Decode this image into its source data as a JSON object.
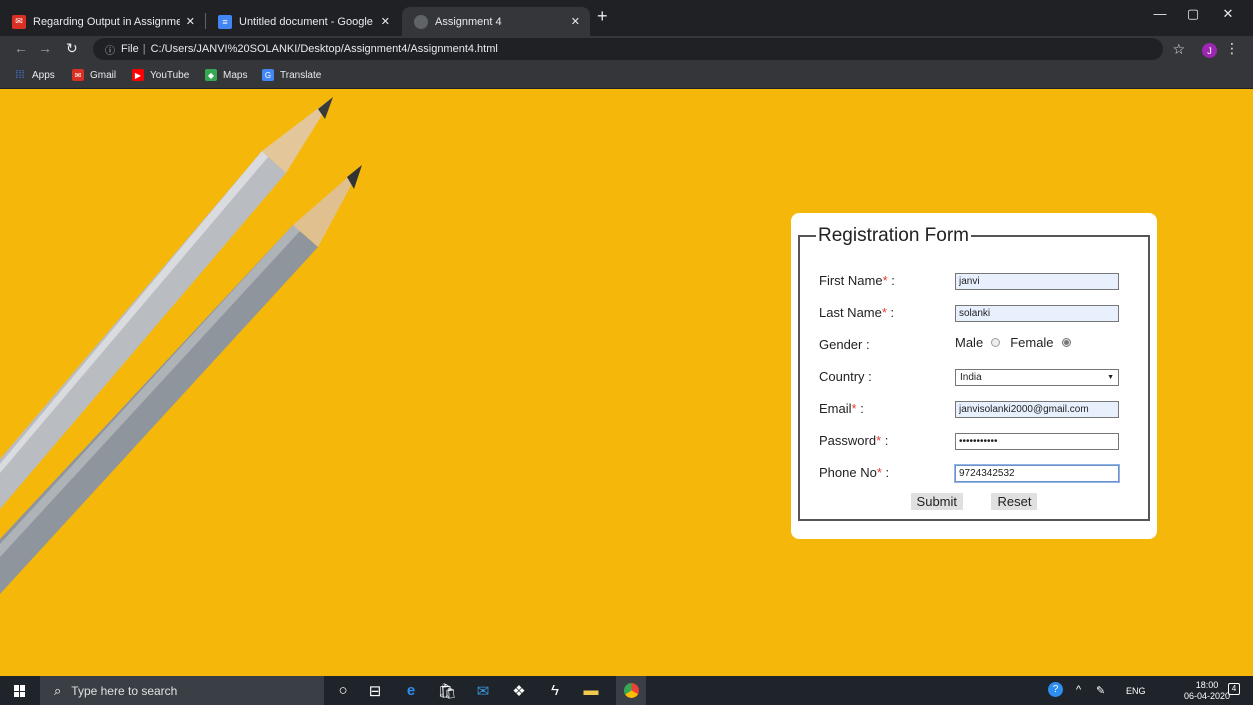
{
  "browser": {
    "tabs": [
      {
        "title": "Regarding Output in Assignment",
        "favicon": "gmail-icon",
        "color": "#d93025",
        "active": false
      },
      {
        "title": "Untitled document - Google Doc",
        "favicon": "docs-icon",
        "color": "#4285f4",
        "active": false
      },
      {
        "title": "Assignment 4",
        "favicon": "globe-icon",
        "color": "#5f6368",
        "active": true
      }
    ],
    "address": {
      "scheme_label": "File",
      "url": "C:/Users/JANVI%20SOLANKI/Desktop/Assignment4/Assignment4.html"
    },
    "profile_initial": "J",
    "bookmarks": [
      {
        "label": "Apps",
        "icon": "apps-grid-icon"
      },
      {
        "label": "Gmail",
        "icon": "gmail-icon"
      },
      {
        "label": "YouTube",
        "icon": "youtube-icon"
      },
      {
        "label": "Maps",
        "icon": "maps-icon"
      },
      {
        "label": "Translate",
        "icon": "translate-icon"
      }
    ]
  },
  "form": {
    "legend": "Registration Form",
    "fields": {
      "first_name": {
        "label": "First Name",
        "required_mark": "*",
        "suffix": " :",
        "value": "janvi"
      },
      "last_name": {
        "label": "Last Name",
        "required_mark": "*",
        "suffix": " :",
        "value": "solanki"
      },
      "gender": {
        "label": "Gender :",
        "options": [
          "Male",
          "Female"
        ],
        "selected": "Female"
      },
      "country": {
        "label": "Country :",
        "value": "India"
      },
      "email": {
        "label": "Email",
        "required_mark": "*",
        "suffix": " :",
        "value": "janvisolanki2000@gmail.com"
      },
      "password": {
        "label": "Password",
        "required_mark": "*",
        "suffix": " :",
        "value": "•••••••••••"
      },
      "phone": {
        "label": "Phone No",
        "required_mark": "*",
        "suffix": " :",
        "value": "9724342532"
      }
    },
    "submit_label": "Submit",
    "reset_label": "Reset"
  },
  "taskbar": {
    "search_placeholder": "Type here to search",
    "language": "ENG",
    "time": "18:00",
    "date": "06-04-2020",
    "notification_count": "4"
  },
  "colors": {
    "page_background": "#f5b80a",
    "required": "#e53935",
    "autofill": "#e8f0fe"
  }
}
